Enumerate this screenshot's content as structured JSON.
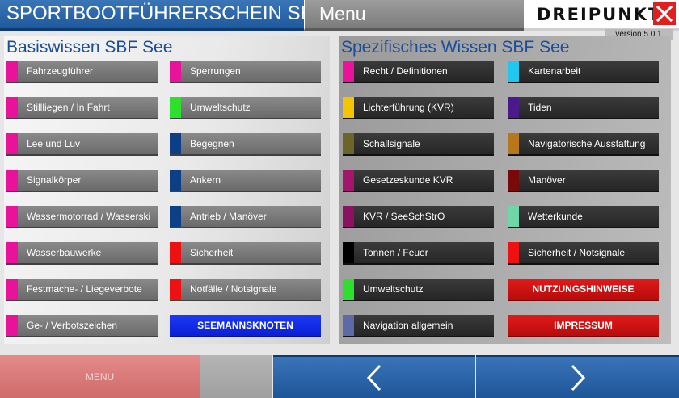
{
  "header": {
    "app_title": "SPORTBOOTFÜHRERSCHEIN SEE",
    "menu_title": "Menu",
    "logo": "DREIPUNKT",
    "version": "version 5.0.1"
  },
  "left_panel": {
    "title": "Basiswissen SBF See",
    "col1": [
      {
        "label": "Fahrzeugführer",
        "accent": "#e8139a"
      },
      {
        "label": "Stillliegen / In Fahrt",
        "accent": "#e8139a"
      },
      {
        "label": "Lee und Luv",
        "accent": "#e8139a"
      },
      {
        "label": "Signalkörper",
        "accent": "#e8139a"
      },
      {
        "label": "Wassermotorrad / Wasserski",
        "accent": "#e8139a"
      },
      {
        "label": "Wasserbauwerke",
        "accent": "#e8139a"
      },
      {
        "label": "Festmache- / Liegeverbote",
        "accent": "#e8139a"
      },
      {
        "label": "Ge- / Verbotszeichen",
        "accent": "#e8139a"
      }
    ],
    "col2": [
      {
        "label": "Sperrungen",
        "accent": "#e8139a"
      },
      {
        "label": "Umweltschutz",
        "accent": "#2ee02e"
      },
      {
        "label": "Begegnen",
        "accent": "#0d3f86"
      },
      {
        "label": "Ankern",
        "accent": "#0d3f86"
      },
      {
        "label": "Antrieb / Manöver",
        "accent": "#0d3f86"
      },
      {
        "label": "Sicherheit",
        "accent": "#ee1111"
      },
      {
        "label": "Notfälle / Notsignale",
        "accent": "#ee1111"
      }
    ],
    "special": {
      "label": "SEEMANNSKNOTEN",
      "color": "#0a1fd6"
    }
  },
  "right_panel": {
    "title": "Spezifisches Wissen SBF See",
    "col1": [
      {
        "label": "Recht / Definitionen",
        "accent": "#e8139a"
      },
      {
        "label": "Lichterführung (KVR)",
        "accent": "#f5c400"
      },
      {
        "label": "Schallsignale",
        "accent": "#6b6528"
      },
      {
        "label": "Gesetzeskunde KVR",
        "accent": "#a3166e"
      },
      {
        "label": "KVR / SeeSchStrO",
        "accent": "#8c1160"
      },
      {
        "label": "Tonnen / Feuer",
        "accent": "#000000"
      },
      {
        "label": "Umweltschutz",
        "accent": "#2ee02e"
      },
      {
        "label": "Navigation allgemein",
        "accent": "#5e6aa8"
      }
    ],
    "col2": [
      {
        "label": "Kartenarbeit",
        "accent": "#22c7f0"
      },
      {
        "label": "Tiden",
        "accent": "#4a1a8c"
      },
      {
        "label": "Navigatorische Ausstattung",
        "accent": "#b8781a"
      },
      {
        "label": "Manöver",
        "accent": "#7a0a0a"
      },
      {
        "label": "Wetterkunde",
        "accent": "#6fd6a8"
      },
      {
        "label": "Sicherheit / Notsignale",
        "accent": "#ee1111"
      }
    ],
    "special": [
      {
        "label": "NUTZUNGSHINWEISE",
        "color": "#d01010"
      },
      {
        "label": "IMPRESSUM",
        "color": "#d01010"
      }
    ]
  },
  "footer": {
    "menu_label": "MENU"
  }
}
